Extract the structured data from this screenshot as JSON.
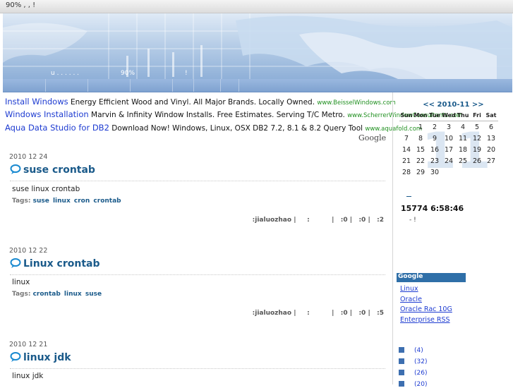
{
  "topbar": {
    "text": "90%     ,     ,     !"
  },
  "banner": {
    "caption_1": "u  .  .  .  .  .  .",
    "caption_2": "90%",
    "caption_3": "!"
  },
  "ads": [
    {
      "title": "Install Windows",
      "desc": " Energy Efficient Wood and Vinyl. All Major Brands. Locally Owned. ",
      "url": "www.BeisselWindows.com"
    },
    {
      "title": "Windows Installation",
      "desc": " Marvin & Infinity Window Installs. Free Estimates. Serving T/C Metro. ",
      "url": "www.ScherrerWindowConsultants.com"
    },
    {
      "title": "Aqua Data Studio for DB2",
      "desc": " Download Now! Windows, Linux, OSX DB2 7.2, 8.1 & 8.2 Query Tool ",
      "url": "www.aquafold.com"
    }
  ],
  "google_label": "Google",
  "posts": [
    {
      "date": "2010   12   24",
      "title": "suse   crontab",
      "body": "suse linux  crontab",
      "tags_label": "Tags:",
      "tags": [
        "suse",
        "linux",
        "cron",
        "crontab"
      ],
      "meta": ":jialuozhao |     :          |   :0 |   :0 |   :2"
    },
    {
      "date": "2010   12   22",
      "title": "Linux              crontab",
      "body": "linux",
      "tags_label": "Tags:",
      "tags": [
        "crontab",
        "linux",
        "suse"
      ],
      "meta": ":jialuozhao |     :          |   :0 |   :0 |   :5"
    },
    {
      "date": "2010   12   21",
      "title": "linux   jdk",
      "body": "linux jdk",
      "tags_label": "",
      "tags": [],
      "meta": ""
    }
  ],
  "calendar": {
    "header": "<< 2010-11 >>",
    "weekdays": [
      "Sun",
      "Mon",
      "Tue",
      "Wed",
      "Thu",
      "Fri",
      "Sat"
    ],
    "weeks": [
      [
        "",
        "1",
        "2",
        "3",
        "4",
        "5",
        "6"
      ],
      [
        "7",
        "8",
        "9",
        "10",
        "11",
        "12",
        "13"
      ],
      [
        "14",
        "15",
        "16",
        "17",
        "18",
        "19",
        "20"
      ],
      [
        "21",
        "22",
        "23",
        "24",
        "25",
        "26",
        "27"
      ],
      [
        "28",
        "29",
        "30",
        "",
        "",
        "",
        ""
      ]
    ],
    "watermark": "11"
  },
  "stats": {
    "visits": "15774  6:58:46",
    "note": "-     !"
  },
  "links": {
    "title": "Google",
    "items": [
      "Linux",
      "Oracle",
      "Oracle Rac 10G",
      "Enterprise RSS"
    ]
  },
  "categories": [
    "(4)",
    "(32)",
    "(26)",
    "(20)"
  ]
}
